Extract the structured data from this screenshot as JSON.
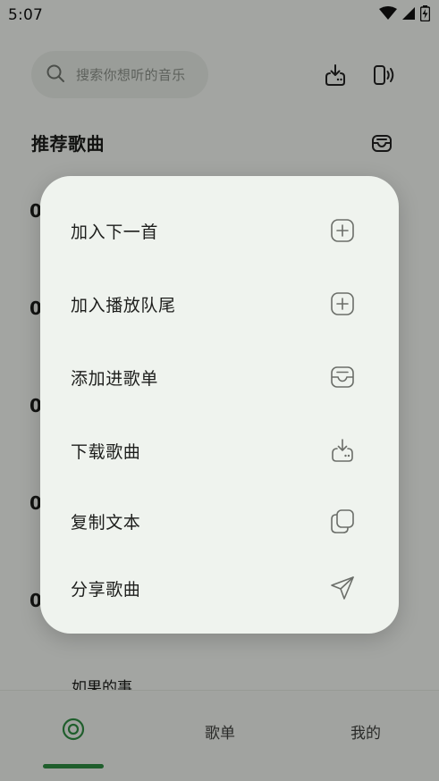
{
  "status_bar": {
    "time": "5:07"
  },
  "search": {
    "placeholder": "搜索你想听的音乐"
  },
  "section": {
    "title": "推荐歌曲"
  },
  "list": {
    "rank_prefixes": [
      "0",
      "0",
      "0",
      "0",
      "0"
    ],
    "peek_song_title": "如果的事"
  },
  "bottom_nav": {
    "tabs": [
      {
        "label": "",
        "icon": "disc-icon",
        "selected": true
      },
      {
        "label": "歌单",
        "selected": false
      },
      {
        "label": "我的",
        "selected": false
      }
    ]
  },
  "context_menu": {
    "items": [
      {
        "label": "加入下一首",
        "icon": "plus-square-icon"
      },
      {
        "label": "加入播放队尾",
        "icon": "plus-square-icon"
      },
      {
        "label": "添加进歌单",
        "icon": "inbox-icon"
      },
      {
        "label": "下载歌曲",
        "icon": "download-icon"
      },
      {
        "label": "复制文本",
        "icon": "copy-icon"
      },
      {
        "label": "分享歌曲",
        "icon": "send-icon"
      }
    ]
  },
  "colors": {
    "accent": "#2e8b42",
    "menu_bg": "#eff3ee",
    "page_bg": "#f1f4ef"
  }
}
